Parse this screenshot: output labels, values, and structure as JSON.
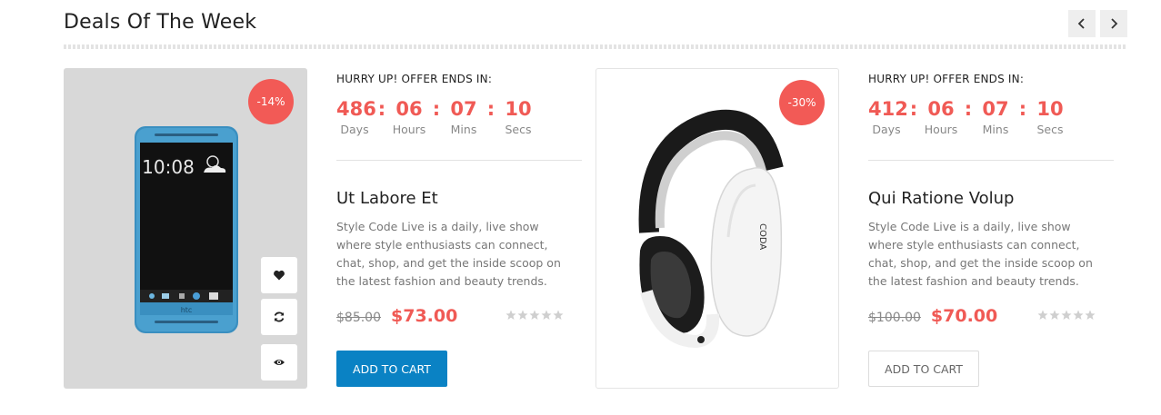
{
  "section": {
    "title": "Deals Of The Week"
  },
  "nav": {
    "prev_icon": "chevron-left-icon",
    "next_icon": "chevron-right-icon"
  },
  "labels": {
    "days": "Days",
    "hours": "Hours",
    "mins": "Mins",
    "secs": "Secs",
    "separator": ":"
  },
  "colors": {
    "accent": "#f05a55",
    "badge": "#f25a56",
    "cart_primary": "#0a82c4"
  },
  "deals": [
    {
      "discount": "-14%",
      "image_icon": "smartphone-image",
      "hurry": "HURRY UP! OFFER ENDS IN:",
      "countdown": {
        "days": "486",
        "hours": "06",
        "mins": "07",
        "secs": "10"
      },
      "name": "Ut Labore Et",
      "description": "Style Code Live is a daily, live show where style enthusiasts can connect, chat, shop, and get the inside scoop on the latest fashion and beauty trends.",
      "old_price": "$85.00",
      "new_price": "$73.00",
      "rating": 0,
      "cart_label": "ADD TO CART",
      "actions": [
        "heart-icon",
        "refresh-icon",
        "eye-icon"
      ]
    },
    {
      "discount": "-30%",
      "image_icon": "headphones-image",
      "hurry": "HURRY UP! OFFER ENDS IN:",
      "countdown": {
        "days": "412",
        "hours": "06",
        "mins": "07",
        "secs": "10"
      },
      "name": "Qui Ratione Volup",
      "description": "Style Code Live is a daily, live show where style enthusiasts can connect, chat, shop, and get the inside scoop on the latest fashion and beauty trends.",
      "old_price": "$100.00",
      "new_price": "$70.00",
      "rating": 0,
      "cart_label": "ADD TO CART"
    }
  ],
  "phone_screen": {
    "time": "10:08",
    "brand": "htc"
  },
  "headphone_brand": "CODA"
}
